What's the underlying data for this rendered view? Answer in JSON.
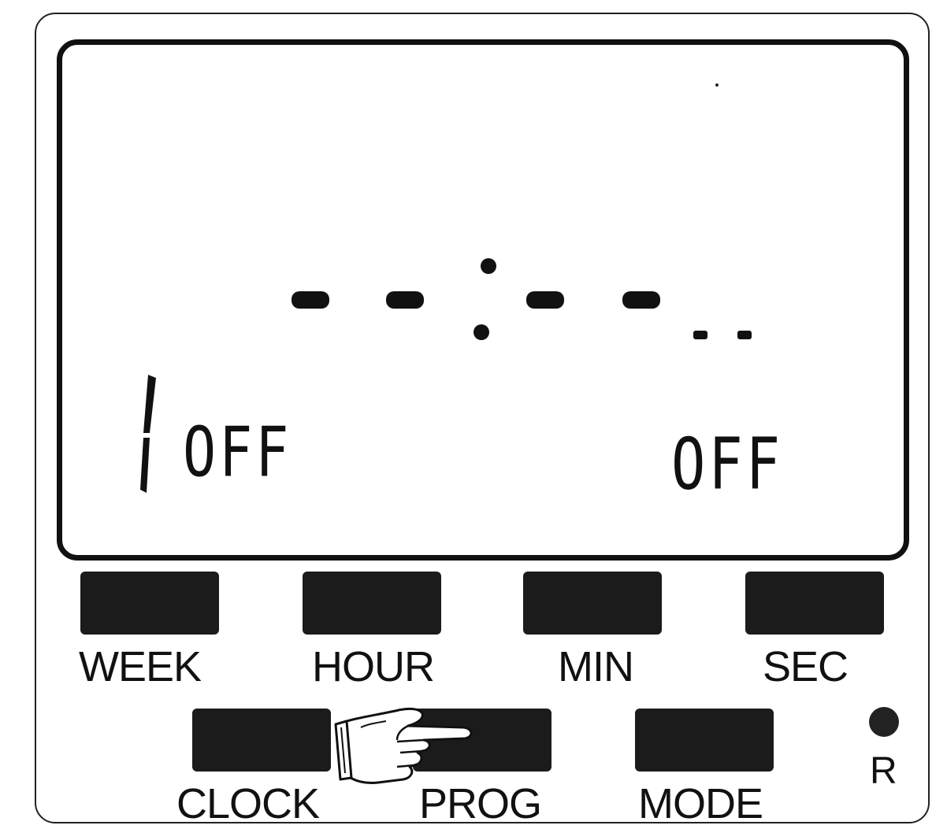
{
  "display": {
    "program_number": "1",
    "left_status": "OFF",
    "right_status": "OFF",
    "time_readout": "--:--"
  },
  "buttons": {
    "week": "WEEK",
    "hour": "HOUR",
    "min": "MIN",
    "sec": "SEC",
    "clock": "CLOCK",
    "prog": "PROG",
    "mode": "MODE",
    "reset": "R"
  },
  "icons": {
    "pointer": "pointing-hand-icon",
    "reset": "reset-dot-icon"
  },
  "colors": {
    "ink": "#111111",
    "button": "#1b1b1b",
    "background": "#ffffff"
  }
}
